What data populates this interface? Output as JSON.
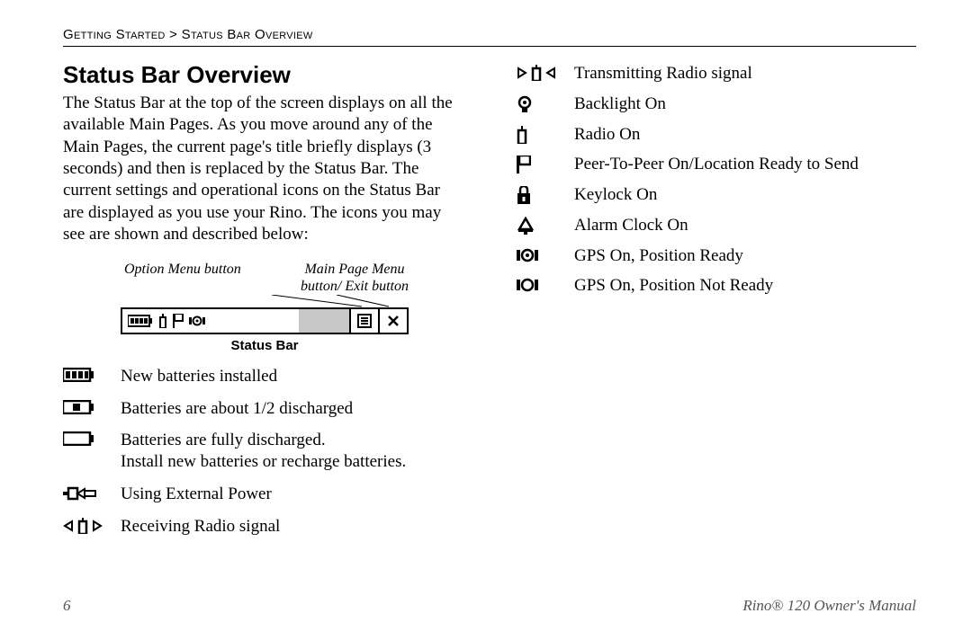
{
  "breadcrumb": {
    "part1": "Getting Started",
    "sep": " > ",
    "part2": "Status Bar Overview"
  },
  "title": "Status Bar Overview",
  "intro": "The Status Bar at the top of the screen displays on all the available Main Pages. As you move around any of the Main Pages, the current page's title briefly displays (3 seconds) and then is replaced by the Status Bar. The current settings and operational icons on the Status Bar are displayed as you use your Rino. The icons you may see are shown and described below:",
  "figure": {
    "callout_left": "Option Menu button",
    "callout_right_l1": "Main Page Menu",
    "callout_right_l2": "button/ Exit button",
    "caption": "Status Bar"
  },
  "left_items": [
    "New batteries installed",
    "Batteries are about 1/2 discharged",
    "Batteries are fully discharged.\nInstall new batteries or recharge batteries.",
    "Using External Power",
    "Receiving Radio signal"
  ],
  "right_items": [
    "Transmitting Radio signal",
    "Backlight On",
    "Radio On",
    "Peer-To-Peer On/Location Ready to Send",
    "Keylock On",
    "Alarm Clock On",
    "GPS On, Position Ready",
    "GPS On, Position Not Ready"
  ],
  "footer": {
    "page": "6",
    "manual": "Rino® 120 Owner's Manual"
  }
}
